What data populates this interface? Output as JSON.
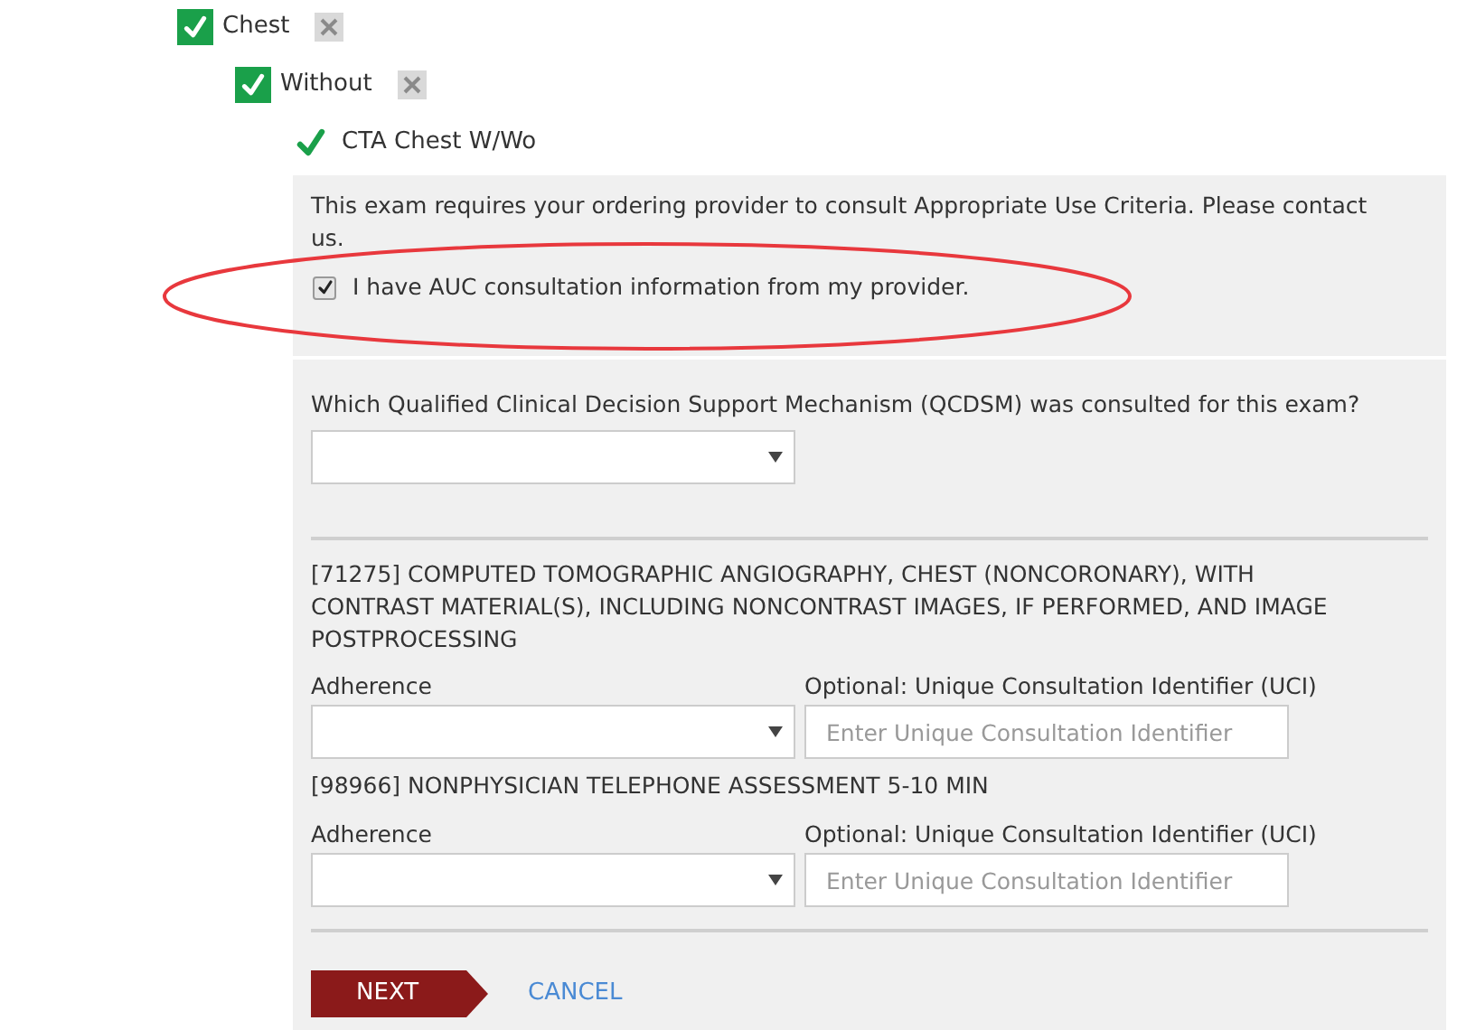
{
  "tree": [
    {
      "kind": "category",
      "label": "Chest",
      "checked": true,
      "removable": true,
      "children": [
        {
          "kind": "category",
          "label": "Without",
          "checked": true,
          "removable": true,
          "children": [
            {
              "kind": "exam",
              "label": "CTA Chest W/Wo",
              "checked": true
            }
          ]
        }
      ]
    }
  ],
  "notice": {
    "text": "This exam requires your ordering provider to consult Appropriate Use Criteria. Please contact us.",
    "checkbox": {
      "label": "I have AUC consultation information from my provider.",
      "checked": true
    }
  },
  "annotation": {
    "kind": "ellipse",
    "color": "#e8383d"
  },
  "qcdsm": {
    "label": "Which Qualified Clinical Decision Support Mechanism (QCDSM) was consulted for this exam?"
  },
  "procedures": [
    {
      "code": "[71275] COMPUTED TOMOGRAPHIC ANGIOGRAPHY, CHEST (NONCORONARY), WITH CONTRAST MATERIAL(S), INCLUDING NONCONTRAST IMAGES, IF PERFORMED, AND IMAGE POSTPROCESSING",
      "adherence_label": "Adherence",
      "uci_label": "Optional: Unique Consultation Identifier (UCI)",
      "uci_placeholder": "Enter Unique Consultation Identifier"
    },
    {
      "code": "[98966] NONPHYSICIAN TELEPHONE ASSESSMENT 5-10 MIN",
      "adherence_label": "Adherence",
      "uci_label": "Optional: Unique Consultation Identifier (UCI)",
      "uci_placeholder": "Enter Unique Consultation Identifier"
    }
  ],
  "buttons": {
    "next": "NEXT",
    "cancel": "CANCEL"
  }
}
